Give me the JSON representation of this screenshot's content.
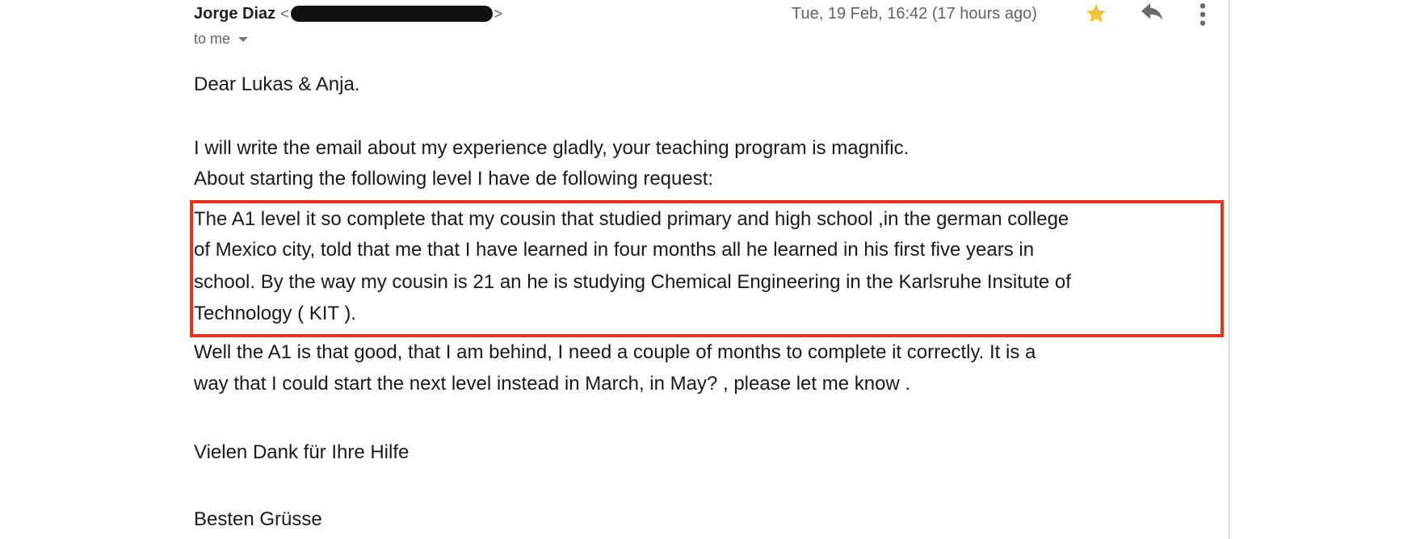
{
  "header": {
    "sender_name": "Jorge Diaz",
    "email_open": "<",
    "email_close": ">",
    "recipient": "to me",
    "timestamp": "Tue, 19 Feb, 16:42 (17 hours ago)"
  },
  "icons": {
    "star": "star-icon",
    "reply": "reply-icon",
    "more": "more-vert-icon",
    "dropdown": "chevron-down-icon"
  },
  "colors": {
    "highlight_border": "#e8321f",
    "star": "#f5c33b"
  },
  "body": {
    "greeting": "Dear Lukas & Anja.",
    "para1_line1": " I will write the email about my experience gladly,  your teaching program is magnific.",
    "para1_line2": " About starting the following level I have de following request:",
    "highlight_line1": " The A1 level it so complete that my cousin that studied primary and high school ,in the german college",
    "highlight_line2": "of Mexico city, told that me that I have learned in four months all he learned in his first five years in",
    "highlight_line3": "school. By the way my cousin is 21 an he is studying Chemical Engineering in the Karlsruhe Insitute of",
    "highlight_line4": "Technology ( KIT ).",
    "para2_line1": " Well the A1 is that good, that I am behind, I need a couple of months to complete it correctly. It is a",
    "para2_line2": "way that I could start the next level instead in March, in May? , please let me know .",
    "closing1": "Vielen Dank für Ihre Hilfe",
    "closing2": "Besten Grüsse"
  }
}
